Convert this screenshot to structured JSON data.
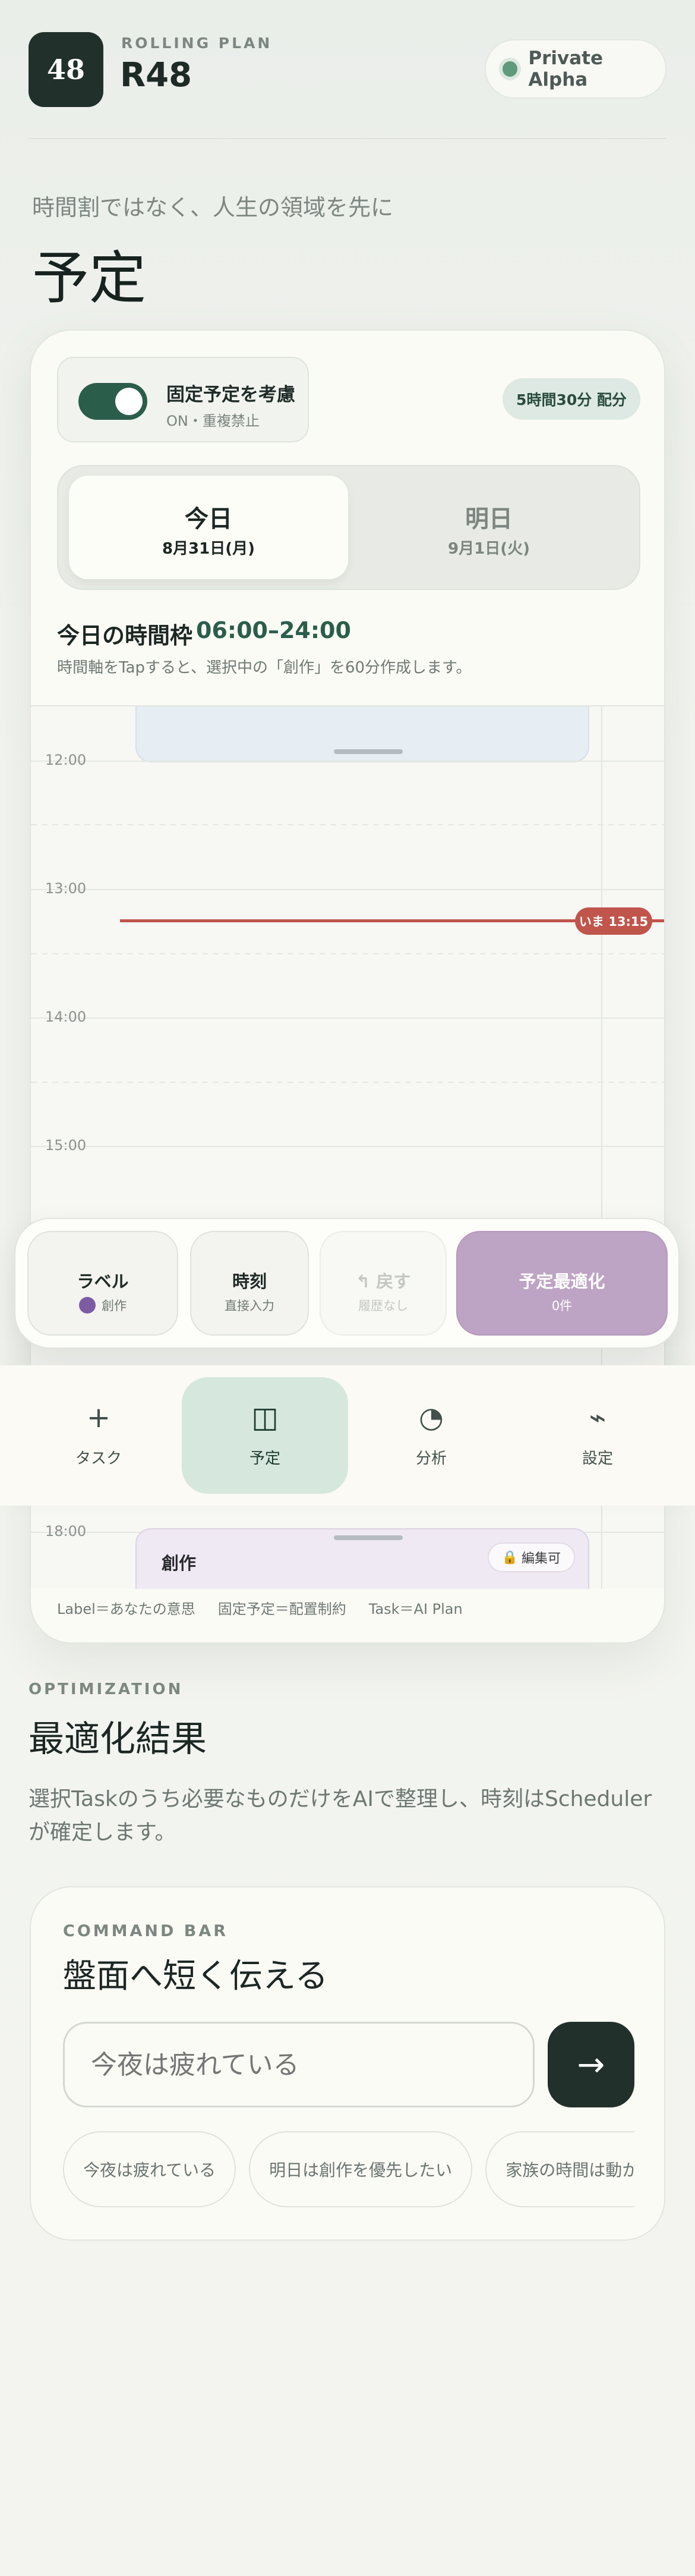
{
  "header": {
    "logo_text": "48",
    "eyebrow": "ROLLING PLAN",
    "title": "R48",
    "status_label": "Private Alpha"
  },
  "page": {
    "subtitle": "時間割ではなく、人生の領域を先に",
    "title": "予定"
  },
  "schedule": {
    "toggle": {
      "title": "固定予定を考慮",
      "sub": "ON・重複禁止",
      "on": true
    },
    "allocation_badge": "5時間30分 配分",
    "days": [
      {
        "label": "今日",
        "date": "8月31日(月)",
        "selected": true
      },
      {
        "label": "明日",
        "date": "9月1日(火)",
        "selected": false
      }
    ],
    "frame_label": "今日の時間枠",
    "frame_value": "06:00–24:00",
    "frame_hint": "時間軸をTapすると、選択中の「創作」を60分作成します。",
    "timeline": {
      "hours": [
        "12:00",
        "13:00",
        "14:00",
        "15:00",
        "18:00"
      ],
      "now_label": "いま 13:15",
      "event_bottom": {
        "title": "創作",
        "lock_label": "編集可"
      }
    },
    "legend": [
      "Label＝あなたの意思",
      "固定予定＝配置制約",
      "Task＝AI Plan"
    ]
  },
  "actions": {
    "label": {
      "title": "ラベル",
      "sub": "創作"
    },
    "time": {
      "title": "時刻",
      "sub": "直接入力"
    },
    "undo": {
      "title": "↰ 戻す",
      "sub": "履歴なし"
    },
    "optimize": {
      "title": "予定最適化",
      "sub": "0件"
    }
  },
  "nav": [
    {
      "icon": "+",
      "label": "タスク",
      "active": false
    },
    {
      "icon": "◫",
      "label": "予定",
      "active": true
    },
    {
      "icon": "◔",
      "label": "分析",
      "active": false
    },
    {
      "icon": "⌁",
      "label": "設定",
      "active": false
    }
  ],
  "optimization": {
    "eyebrow": "OPTIMIZATION",
    "title": "最適化結果",
    "description": "選択Taskのうち必要なものだけをAIで整理し、時刻はSchedulerが確定します。"
  },
  "command": {
    "eyebrow": "COMMAND BAR",
    "title": "盤面へ短く伝える",
    "placeholder": "今夜は疲れている",
    "submit_icon": "→",
    "chips": [
      "今夜は疲れている",
      "明日は創作を優先したい",
      "家族の時間は動かさ"
    ]
  },
  "colors": {
    "accent_green": "#2b5d4b",
    "now_red": "#c0554b",
    "optimize_purple": "#bda3c4",
    "label_dot": "#7e5ca4"
  }
}
